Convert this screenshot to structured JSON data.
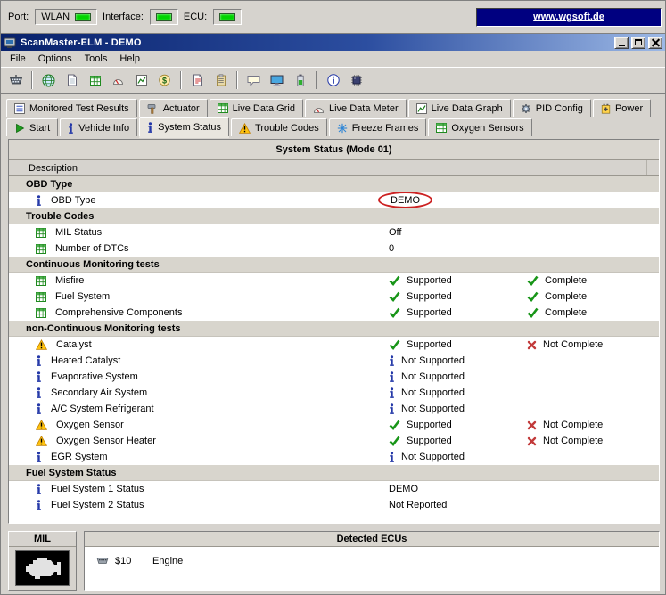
{
  "colors": {
    "led_on": "#00d400",
    "link_bg": "#000080",
    "highlight_ellipse": "#cc2222"
  },
  "connection_bar": {
    "port_label": "Port:",
    "port_value": "WLAN",
    "interface_label": "Interface:",
    "ecu_label": "ECU:",
    "website_link": "www.wgsoft.de"
  },
  "window": {
    "title": "ScanMaster-ELM - DEMO"
  },
  "menu_bar": {
    "items": [
      "File",
      "Options",
      "Tools",
      "Help"
    ]
  },
  "toolbar": {
    "groups": [
      [
        "obd-plug"
      ],
      [
        "globe",
        "document",
        "grid",
        "meter",
        "graph",
        "dollar"
      ],
      [
        "report",
        "clipboard"
      ],
      [
        "chat",
        "monitor",
        "battery"
      ],
      [
        "about-info",
        "chip"
      ]
    ]
  },
  "tab_rows": [
    {
      "tabs": [
        {
          "label": "Monitored Test Results",
          "icon": "list"
        },
        {
          "label": "Actuator",
          "icon": "actuator"
        },
        {
          "label": "Live Data Grid",
          "icon": "grid"
        },
        {
          "label": "Live Data Meter",
          "icon": "meter"
        },
        {
          "label": "Live Data Graph",
          "icon": "graph"
        },
        {
          "label": "PID Config",
          "icon": "gear"
        },
        {
          "label": "Power",
          "icon": "power"
        }
      ]
    },
    {
      "tabs": [
        {
          "label": "Start",
          "icon": "start"
        },
        {
          "label": "Vehicle Info",
          "icon": "info"
        },
        {
          "label": "System Status",
          "icon": "info",
          "active": true
        },
        {
          "label": "Trouble Codes",
          "icon": "warning"
        },
        {
          "label": "Freeze Frames",
          "icon": "snowflake"
        },
        {
          "label": "Oxygen Sensors",
          "icon": "grid"
        }
      ]
    }
  ],
  "status_panel": {
    "title": "System Status (Mode 01)",
    "columns": [
      "Description",
      "",
      "",
      ""
    ],
    "sections": [
      {
        "title": "OBD Type",
        "rows": [
          {
            "icon": "info",
            "label": "OBD Type",
            "value": "DEMO",
            "circled": true
          }
        ]
      },
      {
        "title": "Trouble Codes",
        "rows": [
          {
            "icon": "grid",
            "label": "MIL Status",
            "value": "Off"
          },
          {
            "icon": "grid",
            "label": "Number of DTCs",
            "value": "0"
          }
        ]
      },
      {
        "title": "Continuous Monitoring tests",
        "rows": [
          {
            "icon": "grid",
            "label": "Misfire",
            "value": "Supported",
            "value_icon": "check",
            "status": "Complete",
            "status_icon": "check"
          },
          {
            "icon": "grid",
            "label": "Fuel System",
            "value": "Supported",
            "value_icon": "check",
            "status": "Complete",
            "status_icon": "check"
          },
          {
            "icon": "grid",
            "label": "Comprehensive Components",
            "value": "Supported",
            "value_icon": "check",
            "status": "Complete",
            "status_icon": "check"
          }
        ]
      },
      {
        "title": "non-Continuous Monitoring tests",
        "rows": [
          {
            "icon": "warning",
            "label": "Catalyst",
            "value": "Supported",
            "value_icon": "check",
            "status": "Not Complete",
            "status_icon": "cross"
          },
          {
            "icon": "info",
            "label": "Heated Catalyst",
            "value": "Not Supported",
            "value_icon": "info"
          },
          {
            "icon": "info",
            "label": "Evaporative System",
            "value": "Not Supported",
            "value_icon": "info"
          },
          {
            "icon": "info",
            "label": "Secondary Air System",
            "value": "Not Supported",
            "value_icon": "info"
          },
          {
            "icon": "info",
            "label": "A/C System Refrigerant",
            "value": "Not Supported",
            "value_icon": "info"
          },
          {
            "icon": "warning",
            "label": "Oxygen Sensor",
            "value": "Supported",
            "value_icon": "check",
            "status": "Not Complete",
            "status_icon": "cross"
          },
          {
            "icon": "warning",
            "label": "Oxygen Sensor Heater",
            "value": "Supported",
            "value_icon": "check",
            "status": "Not Complete",
            "status_icon": "cross"
          },
          {
            "icon": "info",
            "label": "EGR System",
            "value": "Not Supported",
            "value_icon": "info"
          }
        ]
      },
      {
        "title": "Fuel System Status",
        "rows": [
          {
            "icon": "info",
            "label": "Fuel System 1 Status",
            "value": "DEMO"
          },
          {
            "icon": "info",
            "label": "Fuel System 2 Status",
            "value": "Not Reported"
          }
        ]
      }
    ]
  },
  "mil_panel": {
    "title": "MIL",
    "lamp_icon": "engine"
  },
  "detected_ecus": {
    "title": "Detected ECUs",
    "entries": [
      {
        "icon": "ecu-plug",
        "address": "$10",
        "name": "Engine"
      }
    ]
  }
}
